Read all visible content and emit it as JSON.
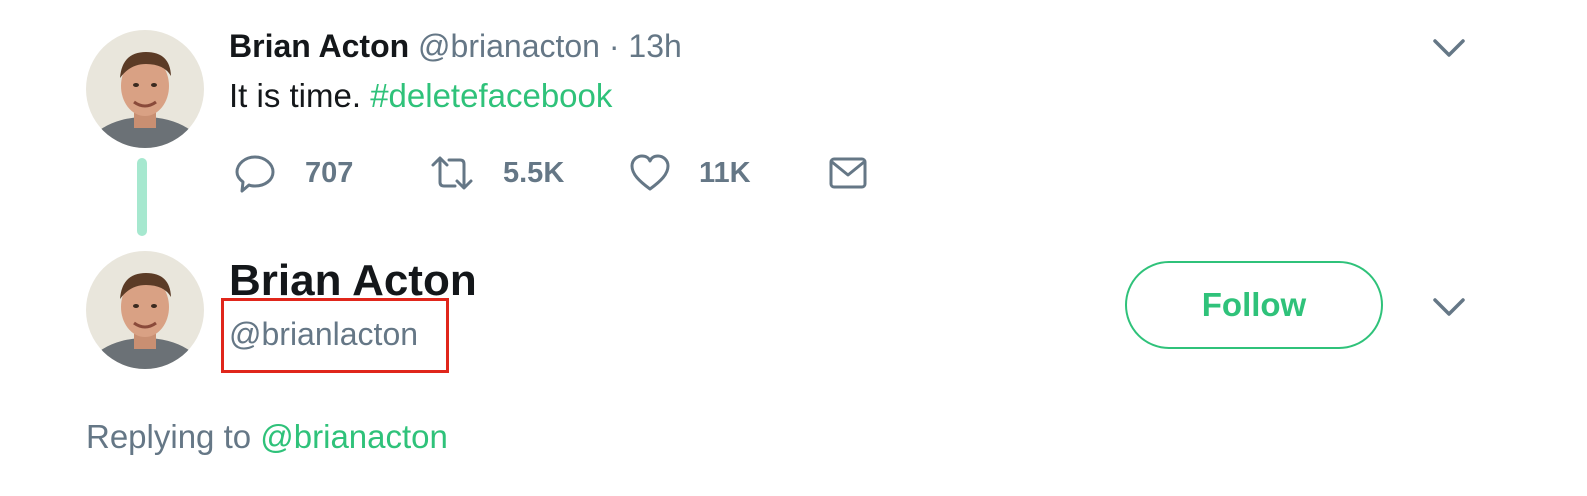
{
  "tweet": {
    "author_name": "Brian Acton",
    "author_handle": "@brianacton",
    "separator": "·",
    "timestamp": "13h",
    "text_plain": "It is time. ",
    "hashtag": "#deletefacebook",
    "stats": {
      "replies": "707",
      "retweets": "5.5K",
      "likes": "11K"
    },
    "menu_icon": "chevron-down-icon"
  },
  "profile": {
    "name": "Brian Acton",
    "handle": "@brianlacton",
    "follow_label": "Follow",
    "menu_icon": "chevron-down-icon"
  },
  "reply_context": {
    "prefix": "Replying to ",
    "mention": "@brianacton"
  },
  "colors": {
    "accent": "#2fc27a",
    "thread_line": "#a6e8cf",
    "secondary_text": "#657786",
    "primary_text": "#14171a",
    "highlight_box": "#e0261b"
  },
  "icons": {
    "reply": "reply-icon",
    "retweet": "retweet-icon",
    "like": "heart-icon",
    "dm": "envelope-icon"
  }
}
